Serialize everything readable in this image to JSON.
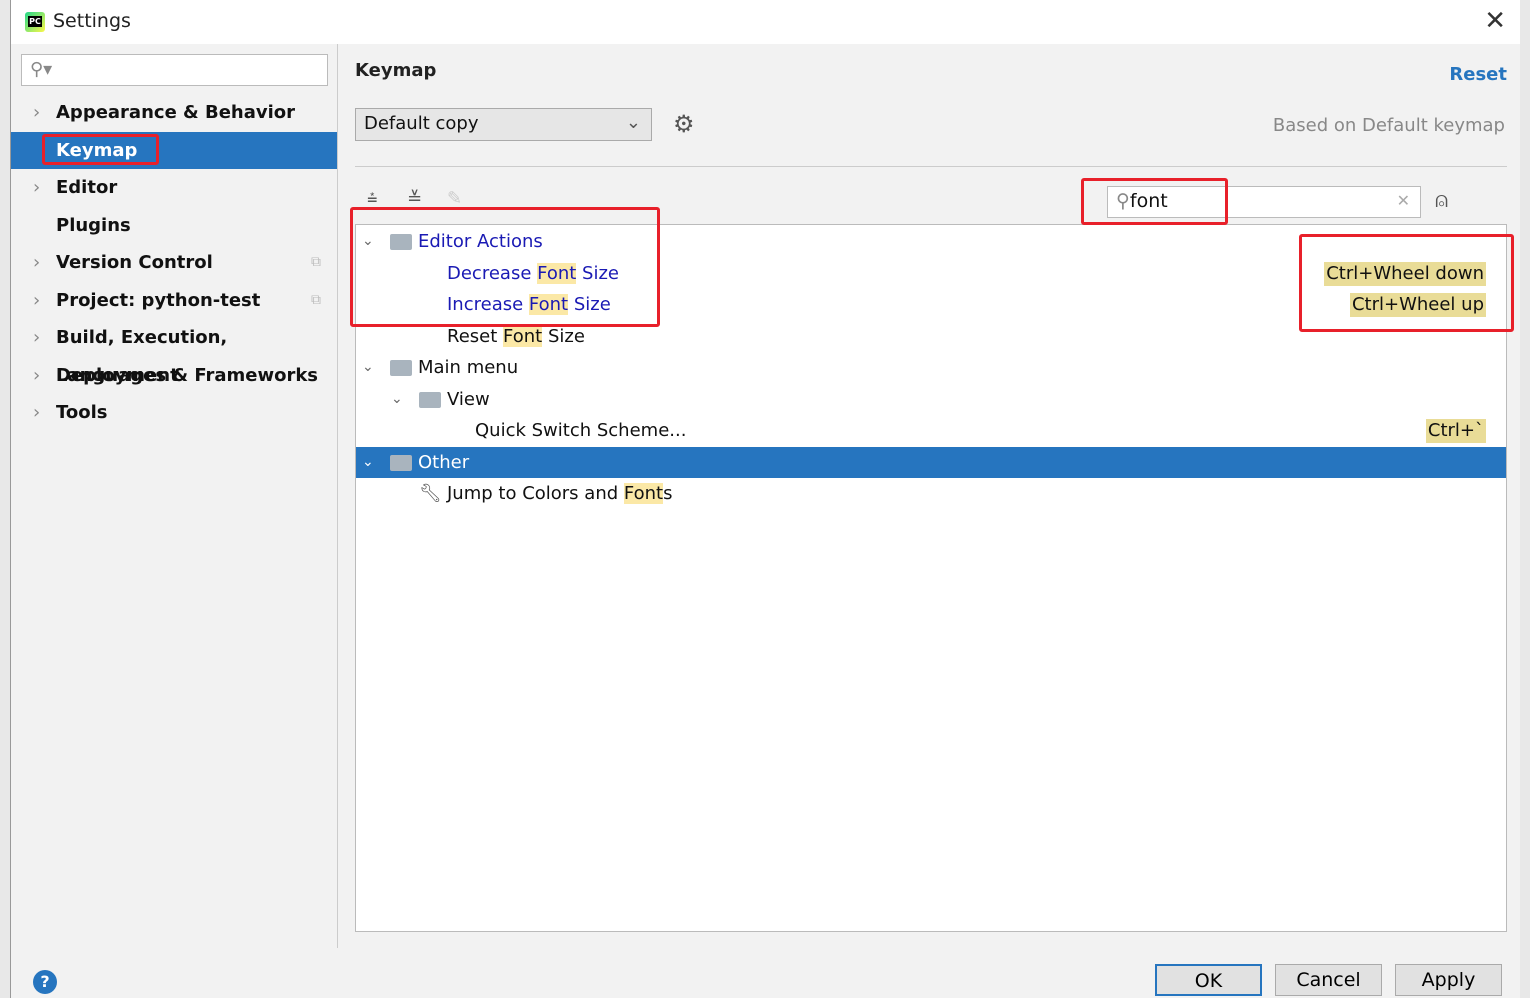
{
  "window": {
    "title": "Settings"
  },
  "sidebar": {
    "search_placeholder": "",
    "items": [
      {
        "label": "Appearance & Behavior",
        "expandable": true
      },
      {
        "label": "Keymap",
        "selected": true
      },
      {
        "label": "Editor",
        "expandable": true
      },
      {
        "label": "Plugins"
      },
      {
        "label": "Version Control",
        "expandable": true
      },
      {
        "label": "Project: python-test",
        "expandable": true
      },
      {
        "label": "Build, Execution, Deployment",
        "expandable": true
      },
      {
        "label": "Languages & Frameworks",
        "expandable": true
      },
      {
        "label": "Tools",
        "expandable": true
      }
    ]
  },
  "main": {
    "heading": "Keymap",
    "reset": "Reset",
    "keymap_select": "Default copy",
    "based_on": "Based on Default keymap",
    "search_value": "font",
    "tree": [
      {
        "pre": "Editor Actions",
        "hl": "",
        "post": "",
        "shortcut": ""
      },
      {
        "pre": "Decrease ",
        "hl": "Font",
        "post": " Size",
        "shortcut": "Ctrl+Wheel down"
      },
      {
        "pre": "Increase ",
        "hl": "Font",
        "post": " Size",
        "shortcut": "Ctrl+Wheel up"
      },
      {
        "pre": "Reset ",
        "hl": "Font",
        "post": " Size",
        "shortcut": ""
      },
      {
        "pre": "Main menu",
        "hl": "",
        "post": "",
        "shortcut": ""
      },
      {
        "pre": "View",
        "hl": "",
        "post": "",
        "shortcut": ""
      },
      {
        "pre": "Quick Switch Scheme...",
        "hl": "",
        "post": "",
        "shortcut": "Ctrl+`"
      },
      {
        "pre": "Other",
        "hl": "",
        "post": "",
        "shortcut": ""
      },
      {
        "pre": "Jump to Colors and ",
        "hl": "Font",
        "post": "s",
        "shortcut": ""
      }
    ]
  },
  "footer": {
    "ok": "OK",
    "cancel": "Cancel",
    "apply": "Apply",
    "help": "?"
  }
}
